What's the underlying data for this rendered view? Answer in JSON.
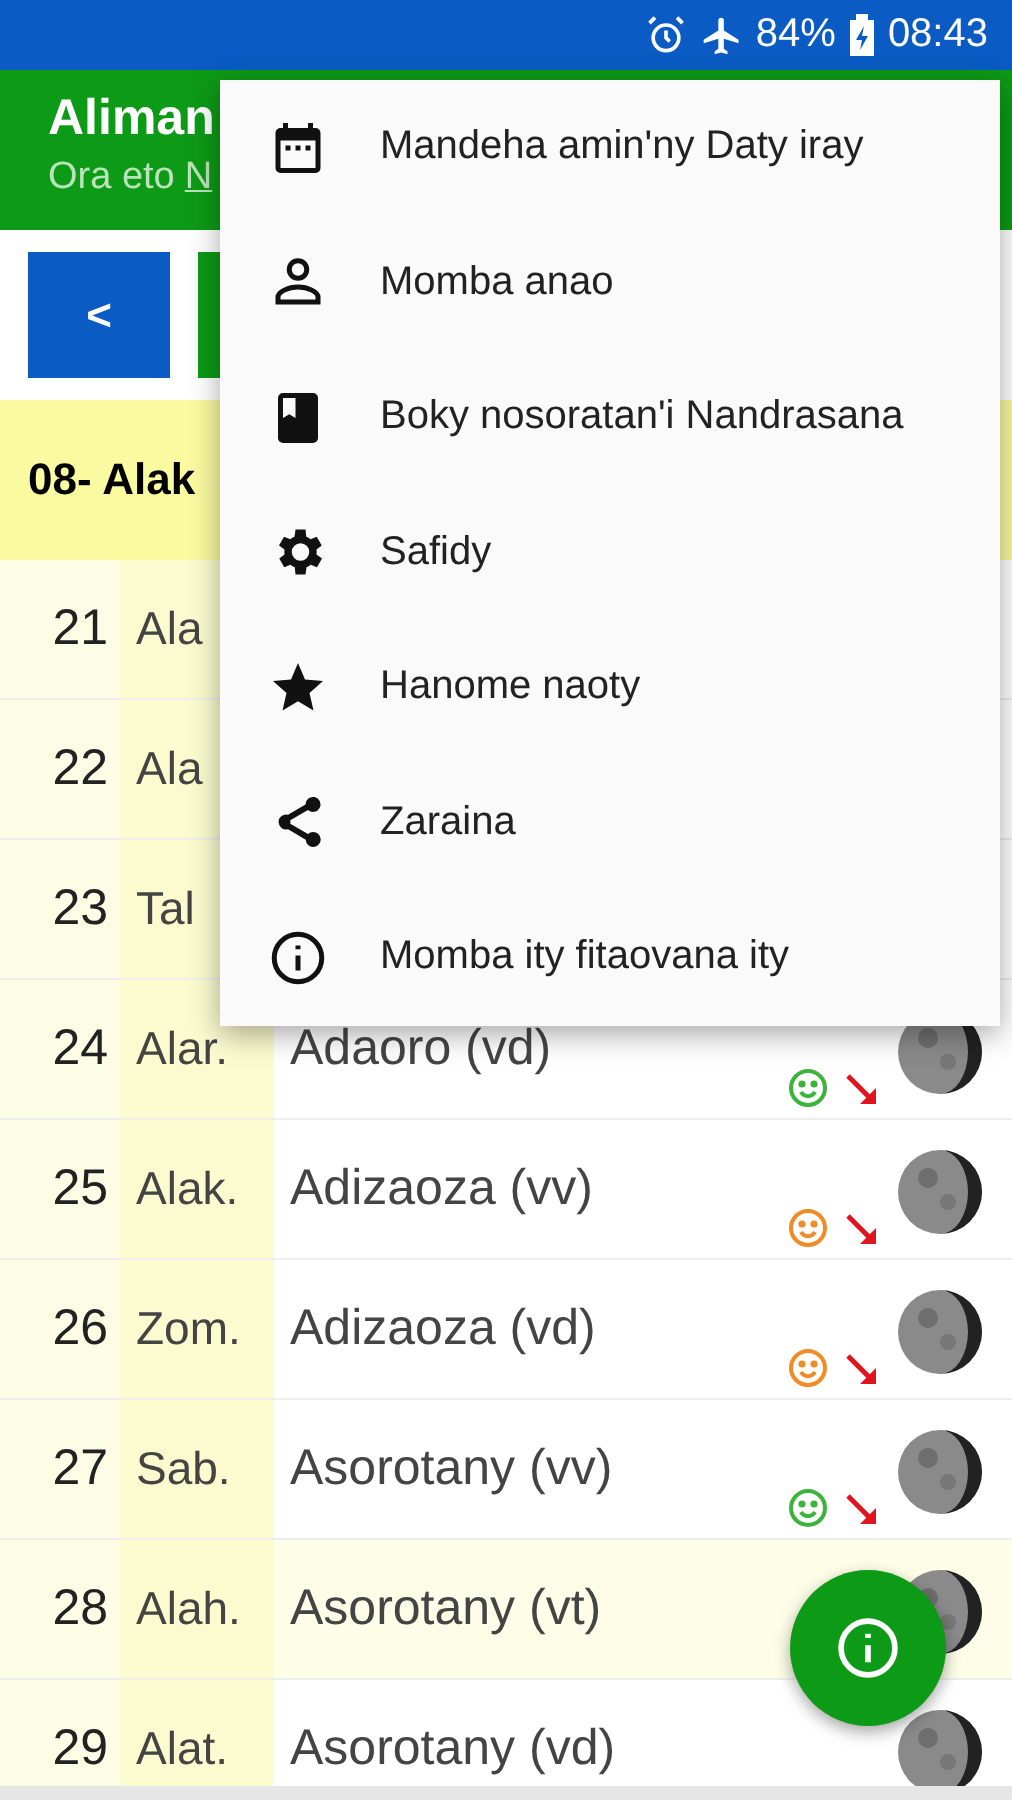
{
  "status_bar": {
    "battery": "84%",
    "time": "08:43"
  },
  "app_bar": {
    "title": "Aliman",
    "subtitle": "Ora eto",
    "subtitle_link": "N"
  },
  "toolbar": {
    "prev_button": "<"
  },
  "month_header": "08- Alak",
  "rows": [
    {
      "day": "21",
      "weekday": "Ala",
      "name": "",
      "mood": null,
      "highlighted": false
    },
    {
      "day": "22",
      "weekday": "Ala",
      "name": "",
      "mood": null,
      "highlighted": false
    },
    {
      "day": "23",
      "weekday": "Tal",
      "name": "",
      "mood": null,
      "highlighted": false
    },
    {
      "day": "24",
      "weekday": "Alar.",
      "name": "Adaoro (vd)",
      "mood": {
        "color": "#3cb43c"
      },
      "highlighted": false
    },
    {
      "day": "25",
      "weekday": "Alak.",
      "name": "Adizaoza (vv)",
      "mood": {
        "color": "#f08c28"
      },
      "highlighted": false
    },
    {
      "day": "26",
      "weekday": "Zom.",
      "name": "Adizaoza (vd)",
      "mood": {
        "color": "#f08c28"
      },
      "highlighted": false
    },
    {
      "day": "27",
      "weekday": "Sab.",
      "name": "Asorotany (vv)",
      "mood": {
        "color": "#3cb43c"
      },
      "highlighted": false
    },
    {
      "day": "28",
      "weekday": "Alah.",
      "name": "Asorotany (vt)",
      "mood": null,
      "highlighted": true
    },
    {
      "day": "29",
      "weekday": "Alat.",
      "name": "Asorotany (vd)",
      "mood": null,
      "highlighted": false
    }
  ],
  "menu": [
    {
      "kind": "calendar",
      "label": "Mandeha amin'ny Daty iray"
    },
    {
      "kind": "person",
      "label": "Momba anao"
    },
    {
      "kind": "book",
      "label": "Boky nosoratan'i Nandrasana"
    },
    {
      "kind": "gear",
      "label": "Safidy"
    },
    {
      "kind": "star",
      "label": "Hanome naoty"
    },
    {
      "kind": "share",
      "label": "Zaraina"
    },
    {
      "kind": "info",
      "label": "Momba ity fitaovana ity"
    }
  ]
}
